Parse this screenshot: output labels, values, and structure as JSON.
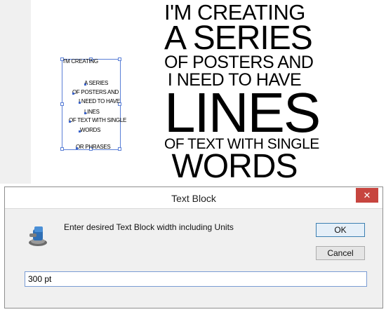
{
  "poster": {
    "lines": [
      "I'M CREATING",
      "A SERIES",
      "OF POSTERS AND",
      "I NEED TO HAVE",
      "LINES",
      "OF TEXT WITH SINGLE",
      "WORDS"
    ]
  },
  "text_frame": {
    "lines": [
      "I'M CREATING",
      "A SERIES",
      "OF POSTERS AND",
      "I NEED TO HAVE",
      "LINES",
      "OF TEXT WITH SINGLE",
      "WORDS",
      "OR PHRASES"
    ]
  },
  "dialog": {
    "title": "Text Block",
    "close_label": "✕",
    "prompt": "Enter desired Text Block width including Units",
    "ok_label": "OK",
    "cancel_label": "Cancel",
    "input_value": "300 pt"
  },
  "colors": {
    "selection": "#5a7fd6",
    "close_button": "#c7453f"
  }
}
